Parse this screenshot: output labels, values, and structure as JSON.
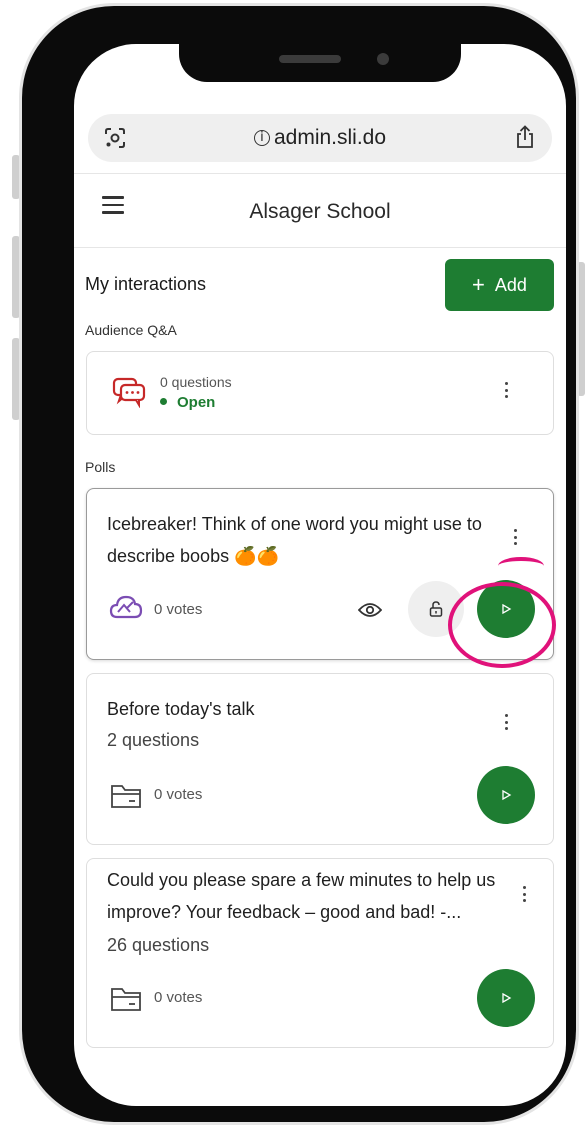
{
  "browser": {
    "url": "admin.sli.do",
    "info_icon": "i"
  },
  "appbar": {
    "title": "Alsager School",
    "menu_icon": "hamburger-menu-icon"
  },
  "interactions": {
    "title": "My interactions",
    "add_label": "Add",
    "add_icon": "+"
  },
  "qa": {
    "section_label": "Audience Q&A",
    "count_text": "0 questions",
    "status_text": "Open",
    "status_color": "#1e7d32"
  },
  "polls": {
    "section_label": "Polls",
    "items": [
      {
        "title": "Icebreaker! Think of one word you might use to describe boobs 🍊🍊",
        "subtitle": "",
        "votes": "0 votes"
      },
      {
        "title": "Before today's talk",
        "subtitle": "2 questions",
        "votes": "0 votes"
      },
      {
        "title": "Could you please spare a few minutes to help us improve? Your feedback – good and bad! -...",
        "subtitle": "26 questions",
        "votes": "0 votes"
      }
    ]
  },
  "colors": {
    "accent": "#1e7d32",
    "highlight": "#e0127a",
    "qa_icon": "#c62828",
    "poll_icon": "#7b4db3"
  }
}
